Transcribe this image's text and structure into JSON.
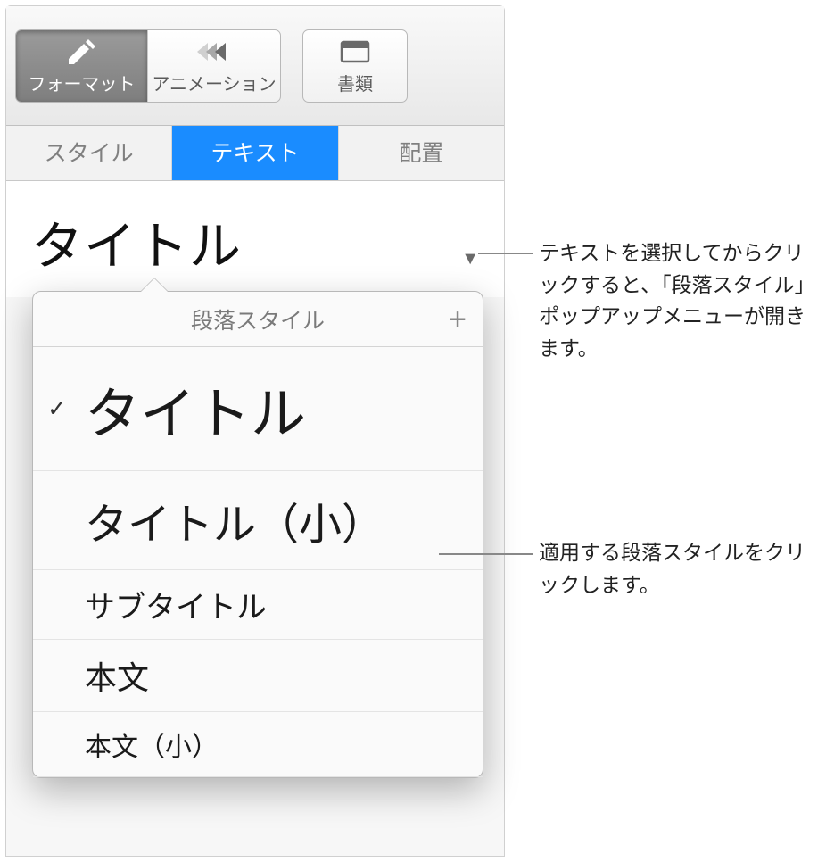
{
  "toolbar": {
    "format_label": "フォーマット",
    "animation_label": "アニメーション",
    "document_label": "書類"
  },
  "tabs": {
    "style": "スタイル",
    "text": "テキスト",
    "arrange": "配置"
  },
  "style_button": {
    "current": "タイトル"
  },
  "popover": {
    "title": "段落スタイル",
    "items": [
      {
        "label": "タイトル",
        "selected": true
      },
      {
        "label": "タイトル（小）",
        "selected": false
      },
      {
        "label": "サブタイトル",
        "selected": false
      },
      {
        "label": "本文",
        "selected": false
      },
      {
        "label": "本文（小）",
        "selected": false
      }
    ]
  },
  "callouts": {
    "c1": "テキストを選択してからクリックすると、「段落スタイル」ポップアップメニューが開きます。",
    "c2": "適用する段落スタイルをクリックします。"
  }
}
